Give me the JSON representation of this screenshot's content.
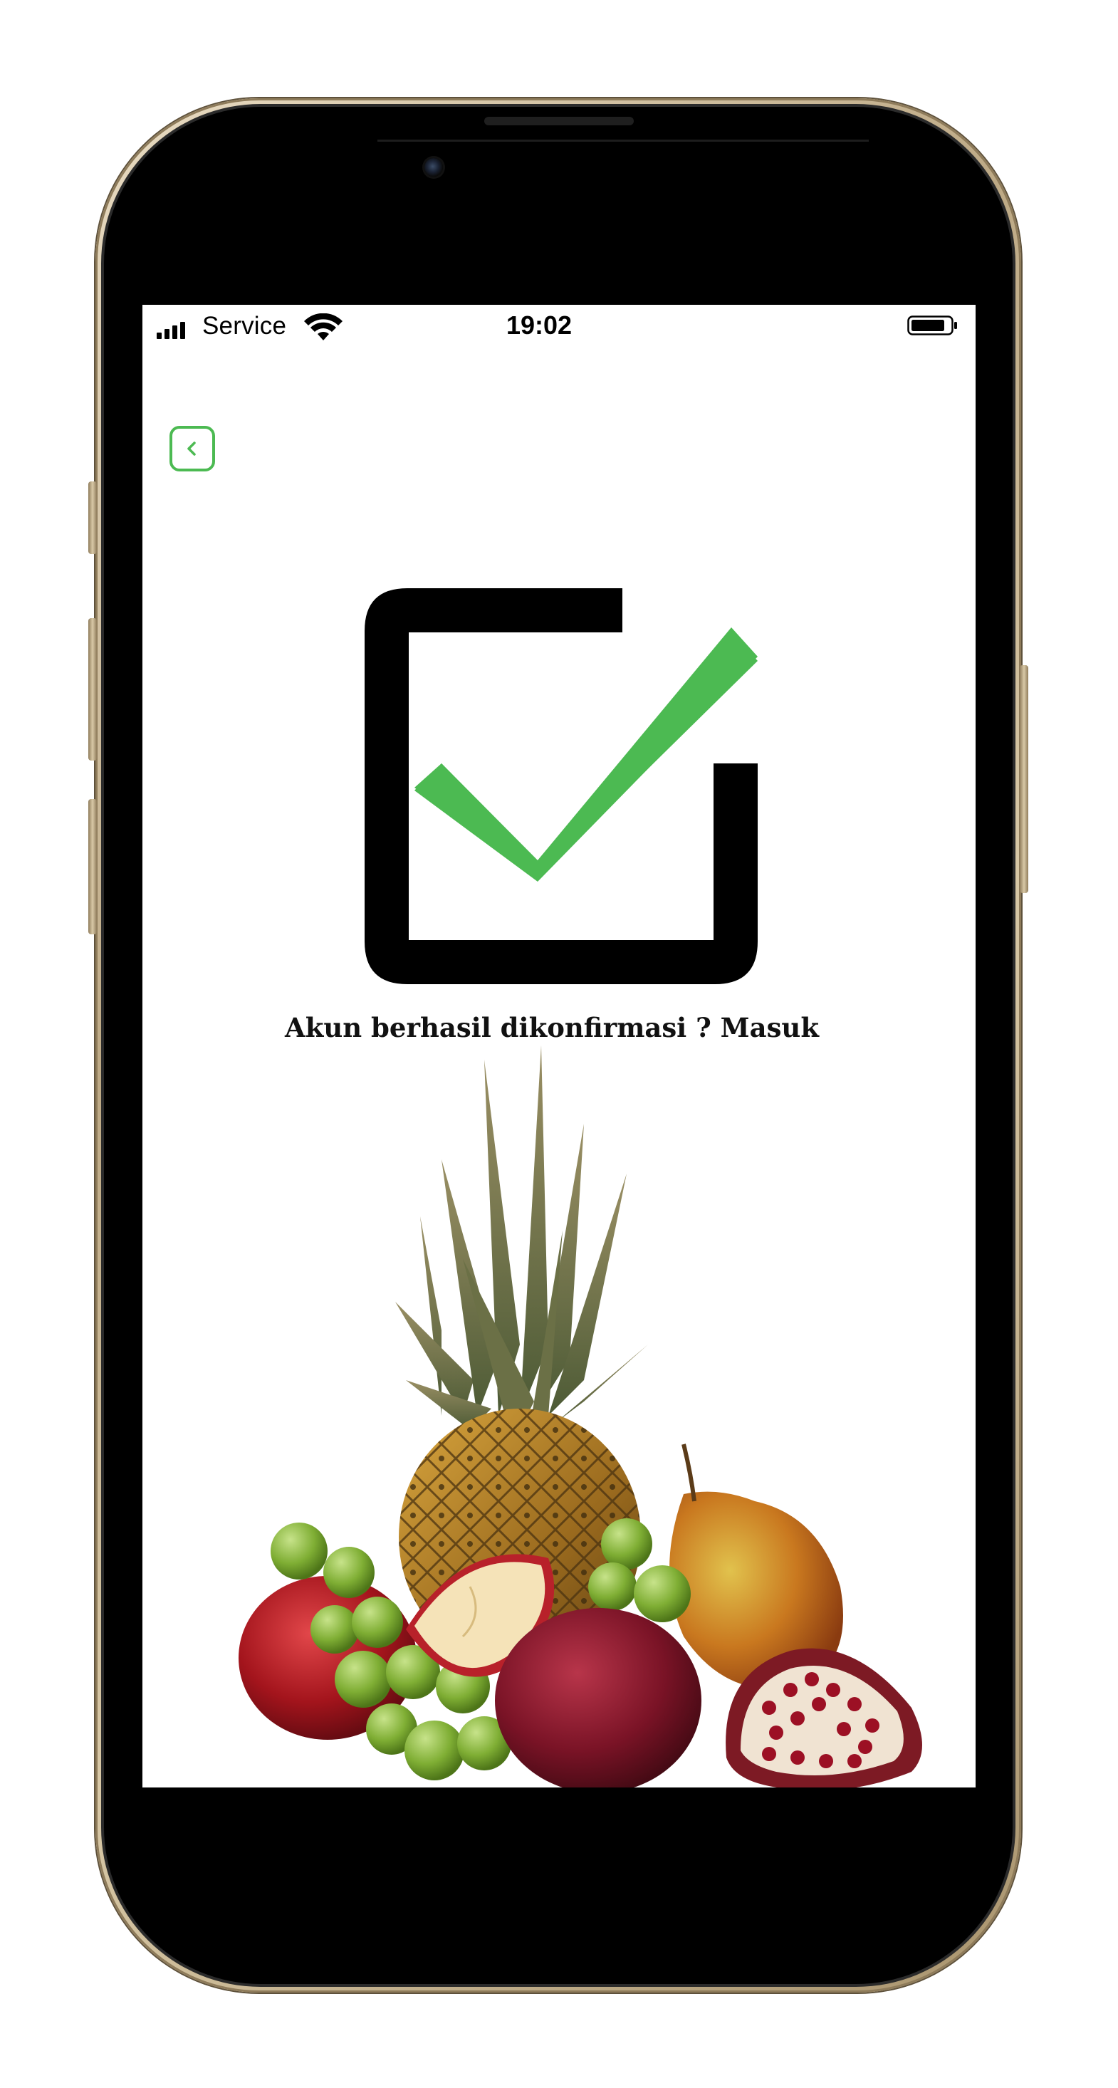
{
  "status_bar": {
    "carrier": "Service",
    "time": "19:02"
  },
  "back_button": {
    "icon": "chevron-left-icon"
  },
  "main": {
    "confirmation_text": "Akun berhasil dikonfirmasi ? Masuk"
  },
  "colors": {
    "accent": "#4cba52",
    "checkbox_frame": "#000000",
    "text": "#111111",
    "phone_frame": "#c9b793"
  }
}
